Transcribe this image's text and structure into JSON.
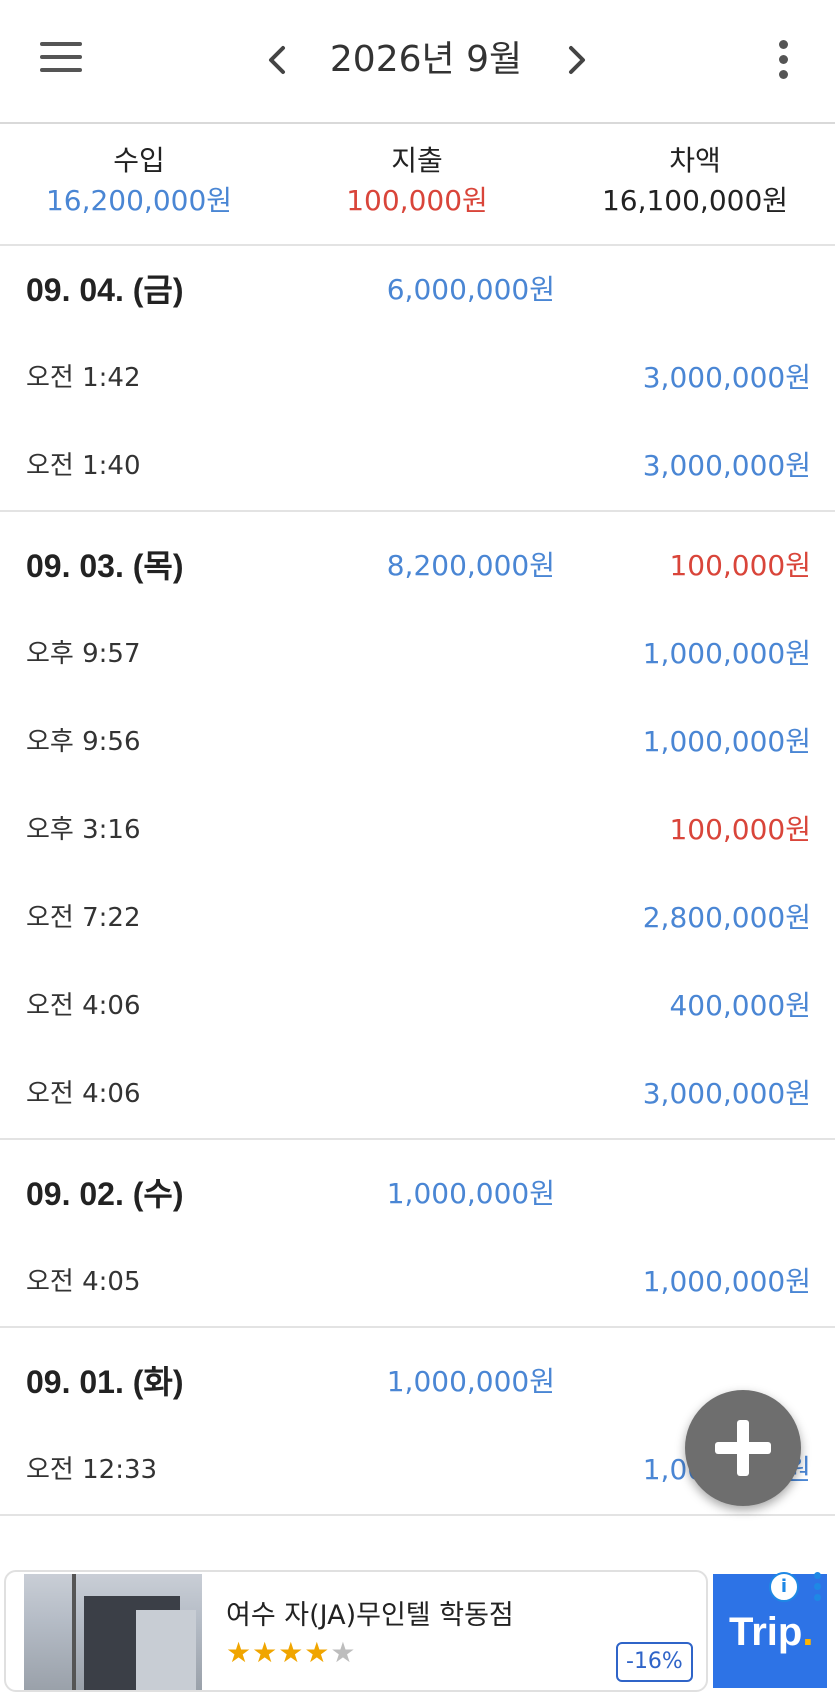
{
  "header": {
    "title": "2026년 9월",
    "prev_icon": "chevron-left-icon",
    "next_icon": "chevron-right-icon",
    "menu_icon": "hamburger-menu-icon",
    "more_icon": "more-vertical-icon"
  },
  "summary": {
    "income_label": "수입",
    "income_value": "16,200,000원",
    "expense_label": "지출",
    "expense_value": "100,000원",
    "balance_label": "차액",
    "balance_value": "16,100,000원"
  },
  "days": [
    {
      "date": "09. 04. (금)",
      "income": "6,000,000원",
      "expense": "",
      "items": [
        {
          "time": "오전 1:42",
          "amount": "3,000,000원",
          "kind": "income"
        },
        {
          "time": "오전 1:40",
          "amount": "3,000,000원",
          "kind": "income"
        }
      ]
    },
    {
      "date": "09. 03. (목)",
      "income": "8,200,000원",
      "expense": "100,000원",
      "items": [
        {
          "time": "오후 9:57",
          "amount": "1,000,000원",
          "kind": "income"
        },
        {
          "time": "오후 9:56",
          "amount": "1,000,000원",
          "kind": "income"
        },
        {
          "time": "오후 3:16",
          "amount": "100,000원",
          "kind": "expense"
        },
        {
          "time": "오전 7:22",
          "amount": "2,800,000원",
          "kind": "income"
        },
        {
          "time": "오전 4:06",
          "amount": "400,000원",
          "kind": "income"
        },
        {
          "time": "오전 4:06",
          "amount": "3,000,000원",
          "kind": "income"
        }
      ]
    },
    {
      "date": "09. 02. (수)",
      "income": "1,000,000원",
      "expense": "",
      "items": [
        {
          "time": "오전 4:05",
          "amount": "1,000,000원",
          "kind": "income"
        }
      ]
    },
    {
      "date": "09. 01. (화)",
      "income": "1,000,000원",
      "expense": "",
      "items": [
        {
          "time": "오전 12:33",
          "amount": "1,000,000원",
          "kind": "income"
        }
      ]
    }
  ],
  "fab_icon": "plus-icon",
  "ad": {
    "title": "여수 자(JA)무인텔 학동점",
    "stars": "★★★★",
    "star_off": "★",
    "discount": "-16%",
    "brand": "Trip",
    "brand_dot": ".",
    "info": "i"
  },
  "colors": {
    "income": "#4a86d4",
    "expense": "#d9453a",
    "fab": "#6e6e6e",
    "trip_brand": "#2d73e6"
  }
}
